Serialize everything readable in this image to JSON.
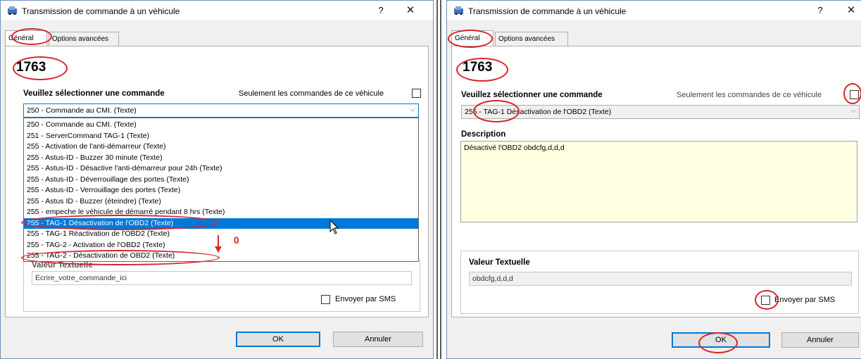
{
  "left": {
    "title": "Transmission de commande à un véhicule",
    "help": "?",
    "close": "✕",
    "tabs": [
      "Général",
      "Options avancées"
    ],
    "id_number": "1763",
    "command_label": "Veuillez sélectionner une commande",
    "only_vehicle_label": "Seulement les commandes de ce véhicule",
    "selected_command": "250 - Commande au CMI.    (Texte)",
    "dropdown_items": [
      "250 - Commande au CMI.    (Texte)",
      "251 - ServerCommand TAG-1    (Texte)",
      "255 - Activation de l'anti-démarreur    (Texte)",
      "255 - Astus-ID - Buzzer 30 minute    (Texte)",
      "255 - Astus-ID - Désactive l'anti-démarreur pour 24h    (Texte)",
      "255 - Astus-ID - Déverrouillage des portes    (Texte)",
      "255 - Astus-ID - Verrouillage des portes    (Texte)",
      "255 - Astus ID - Buzzer (éteindre)    (Texte)",
      "255 - empeche le véhicule de démarré pendant 8 hrs    (Texte)",
      "255 - TAG-1 Désactivation de l'OBD2    (Texte)",
      "255 - TAG-1 Réactivation de l'OBD2    (Texte)",
      "255 - TAG-2 - Activation de l'OBD2    (Texte)",
      "255 - TAG-2 - Désactivation de OBD2    (Texte)"
    ],
    "selected_index": 9,
    "valeur_label": "Valeur Textuelle",
    "textual_value": "Écrire_votre_commande_ici",
    "sms_label": "Envoyer par SMS",
    "ok": "OK",
    "cancel": "Annuler",
    "annotation": "0"
  },
  "right": {
    "title": "Transmission de commande à un véhicule",
    "help": "?",
    "close": "✕",
    "tabs": [
      "Général",
      "Options avancées"
    ],
    "id_number": "1763",
    "command_label": "Veuillez sélectionner une commande",
    "only_vehicle_label": "Seulement les commandes de ce véhicule",
    "selected_command": "255 - TAG-1 Désactivation de l'OBD2    (Texte)",
    "description_label": "Description",
    "description_text": "Désactivé l'OBD2   obdcfg,d,d,d",
    "valeur_label": "Valeur Textuelle",
    "textual_value": "obdcfg,d,d,d",
    "sms_label": "Envoyer par SMS",
    "ok": "OK",
    "cancel": "Annuler"
  },
  "colors": {
    "highlight": "#0078d7",
    "annotation_red": "#d8232a",
    "description_bg": "#ffffe1"
  }
}
